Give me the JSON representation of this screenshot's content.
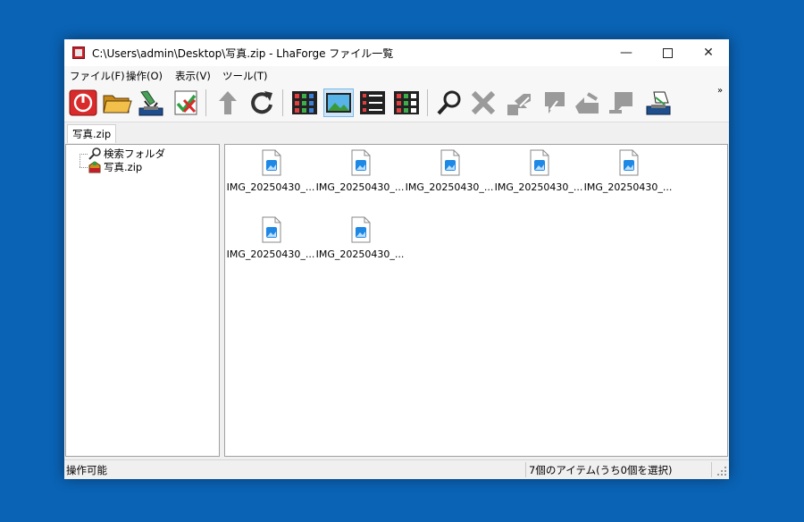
{
  "window": {
    "title": "C:\\Users\\admin\\Desktop\\写真.zip - LhaForge ファイル一覧",
    "minimize_glyph": "—",
    "close_glyph": "✕"
  },
  "menu": [
    "ファイル(F)",
    "操作(O)",
    "表示(V)",
    "ツール(T)"
  ],
  "toolbar": {
    "overflow_glyph": "»",
    "buttons": [
      {
        "name": "close-archive",
        "icon": "power-icon"
      },
      {
        "name": "open-archive",
        "icon": "folder-open-icon"
      },
      {
        "name": "extract",
        "icon": "extract-icon"
      },
      {
        "name": "test-archive",
        "icon": "check-icon"
      },
      {
        "name": "up-folder",
        "icon": "up-arrow-icon"
      },
      {
        "name": "refresh",
        "icon": "refresh-icon"
      },
      {
        "name": "view-small-icons",
        "icon": "grid-view-icon"
      },
      {
        "name": "view-large-icons",
        "icon": "image-view-icon",
        "active": true
      },
      {
        "name": "view-list",
        "icon": "list-view-icon"
      },
      {
        "name": "view-details",
        "icon": "details-view-icon"
      },
      {
        "name": "search",
        "icon": "search-icon"
      },
      {
        "name": "delete",
        "icon": "delete-icon"
      },
      {
        "name": "extract-selected",
        "icon": "extract-arrow-icon"
      },
      {
        "name": "extract-to",
        "icon": "extract-to-icon"
      },
      {
        "name": "extract-here",
        "icon": "extract-here-icon"
      },
      {
        "name": "add-files",
        "icon": "add-icon"
      },
      {
        "name": "send-to",
        "icon": "send-icon"
      }
    ]
  },
  "tab": {
    "label": "写真.zip"
  },
  "tree": [
    {
      "label": "検索フォルダ",
      "icon": "search-folder-icon"
    },
    {
      "label": "写真.zip",
      "icon": "archive-icon"
    }
  ],
  "files": [
    {
      "label": "IMG_20250430_..."
    },
    {
      "label": "IMG_20250430_..."
    },
    {
      "label": "IMG_20250430_..."
    },
    {
      "label": "IMG_20250430_..."
    },
    {
      "label": "IMG_20250430_..."
    },
    {
      "label": "IMG_20250430_..."
    },
    {
      "label": "IMG_20250430_..."
    }
  ],
  "status": {
    "left": "操作可能",
    "right": "7個のアイテム(うち0個を選択)"
  },
  "colors": {
    "desktop": "#0a63b5",
    "accent": "#1e88e5",
    "active_button": "#cce4f7"
  }
}
